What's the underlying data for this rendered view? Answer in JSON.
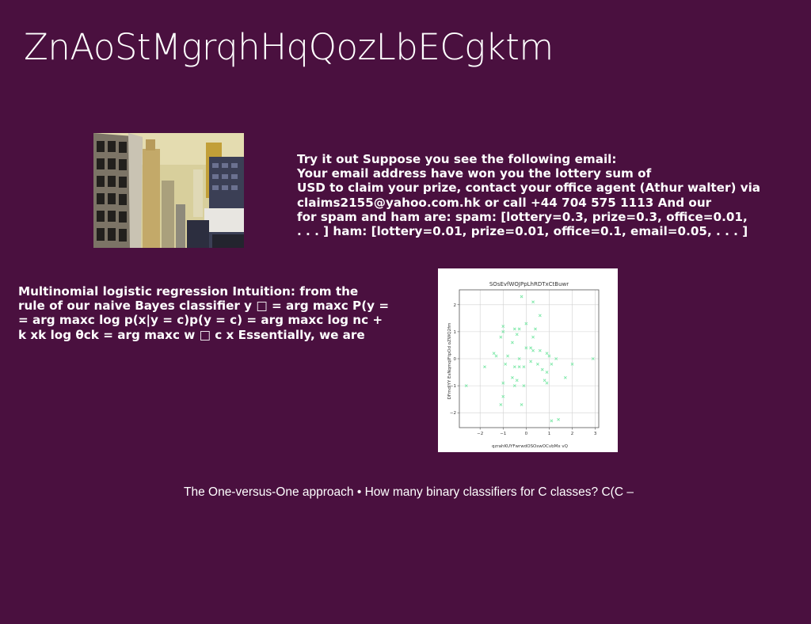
{
  "slide": {
    "title": "ZnAoStMgrqhHqQozLbECgktm",
    "background_color": "#4a103f",
    "text_block_1": [
      "Try it out Suppose you see the following email:",
      "Your email address have won you the lottery sum of",
      "USD to claim your prize, contact your office agent (Athur walter) via",
      "claims2155@yahoo.com.hk or call +44 704 575 1113 And our",
      "for spam and ham are: spam: [lottery=0.3, prize=0.3, office=0.01,",
      ". . . ] ham: [lottery=0.01, prize=0.01, office=0.1, email=0.05, . . . ]"
    ],
    "text_block_2": [
      "Multinomial logistic regression Intuition: from the",
      "rule of our naive Bayes classifier y □ = arg maxc P(y =",
      "= arg maxc log p(x|y = c)p(y = c) = arg maxc log nc +",
      "k xk log θck = arg maxc w □ c x Essentially, we are"
    ],
    "caption": "The One-versus-One approach • How many binary classifiers for C classes? C(C –"
  },
  "chart_data": {
    "type": "scatter",
    "title": "SOsEvfWOJPpLhRDTxCtBuwr",
    "xlabel": "qzrahKUYFwrwdOSOswOCvbMx vQ",
    "ylabel": "DFmdIYY EsNqmqlFtpOd oZWQ2fm",
    "xlim": [
      -2.9,
      3.15
    ],
    "ylim": [
      -2.55,
      2.55
    ],
    "xticks": [
      -2,
      -1,
      0,
      1,
      2,
      3
    ],
    "yticks": [
      -2,
      -1,
      0,
      1,
      2
    ],
    "grid": true,
    "marker": "x",
    "color": "#7de8a8",
    "points": [
      [
        -0.2,
        2.3
      ],
      [
        0.3,
        2.1
      ],
      [
        0.6,
        1.6
      ],
      [
        -1.0,
        1.2
      ],
      [
        -0.5,
        1.1
      ],
      [
        -0.3,
        1.1
      ],
      [
        0.4,
        1.1
      ],
      [
        -1.0,
        1.0
      ],
      [
        -0.4,
        0.9
      ],
      [
        0.0,
        1.3
      ],
      [
        -1.1,
        0.8
      ],
      [
        0.3,
        0.8
      ],
      [
        -0.6,
        0.6
      ],
      [
        0.0,
        0.4
      ],
      [
        0.2,
        0.4
      ],
      [
        -1.4,
        0.2
      ],
      [
        -0.8,
        0.1
      ],
      [
        0.6,
        0.3
      ],
      [
        0.9,
        0.2
      ],
      [
        -1.3,
        0.1
      ],
      [
        0.3,
        0.3
      ],
      [
        1.0,
        0.1
      ],
      [
        1.3,
        0.0
      ],
      [
        -0.3,
        0.0
      ],
      [
        0.2,
        -0.1
      ],
      [
        -0.9,
        -0.2
      ],
      [
        0.5,
        -0.2
      ],
      [
        1.1,
        -0.2
      ],
      [
        -1.8,
        -0.3
      ],
      [
        -0.3,
        -0.3
      ],
      [
        -0.5,
        -0.3
      ],
      [
        0.7,
        -0.4
      ],
      [
        -0.1,
        -0.3
      ],
      [
        0.9,
        -0.5
      ],
      [
        -0.6,
        -0.7
      ],
      [
        1.7,
        -0.7
      ],
      [
        -0.4,
        -0.8
      ],
      [
        0.8,
        -0.8
      ],
      [
        0.9,
        -0.9
      ],
      [
        -1.0,
        -0.9
      ],
      [
        -0.5,
        -1.0
      ],
      [
        -0.1,
        -1.0
      ],
      [
        -2.6,
        -1.0
      ],
      [
        -1.0,
        -1.4
      ],
      [
        -1.1,
        -1.7
      ],
      [
        -0.2,
        -1.7
      ],
      [
        1.1,
        -2.3
      ],
      [
        1.4,
        -2.25
      ],
      [
        2.9,
        0.0
      ],
      [
        2.0,
        -0.2
      ]
    ]
  }
}
